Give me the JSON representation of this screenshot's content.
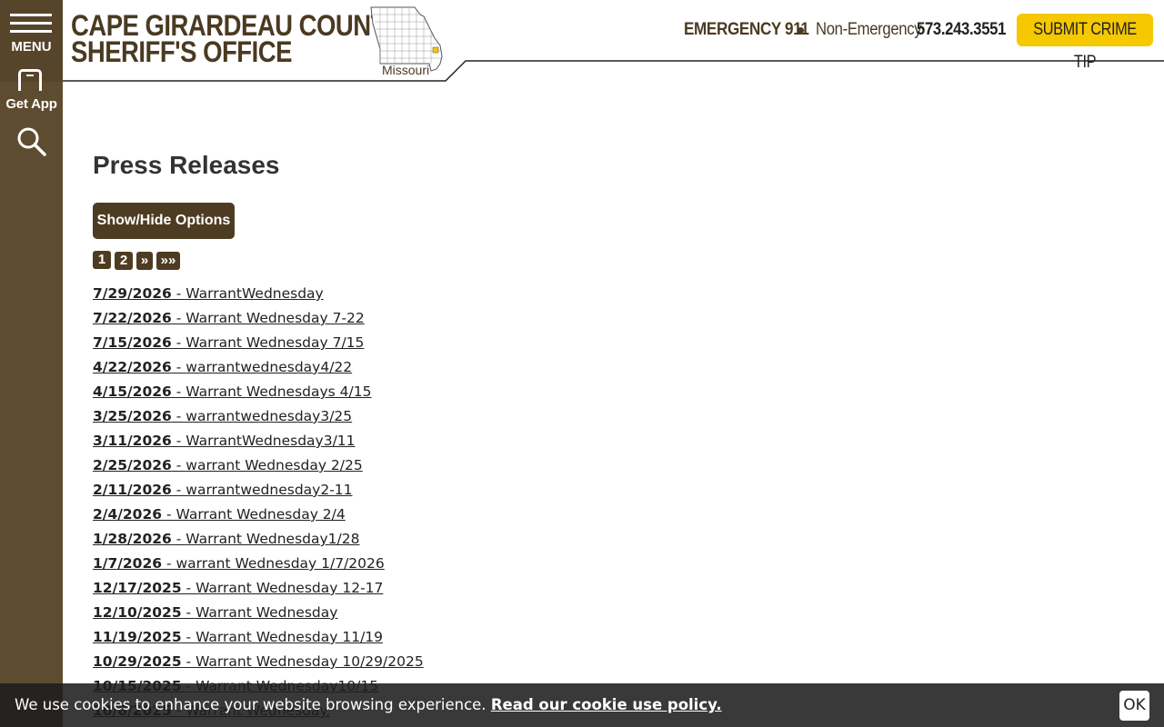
{
  "sidebar": {
    "menu_label": "MENU",
    "app_label": "Get App"
  },
  "header": {
    "brand_line1": "CAPE GIRARDEAU COUNTY",
    "brand_line2": "SHERIFF'S OFFICE",
    "state_label": "Missouri",
    "emergency_label": "EMERGENCY 911",
    "non_emergency_label": "Non-Emergency",
    "non_emergency_phone": "573.243.3551",
    "crime_tip_button": "SUBMIT CRIME TIP"
  },
  "main": {
    "title": "Press Releases",
    "options_button": "Show/Hide Options",
    "pagination": [
      {
        "label": "1",
        "current": true
      },
      {
        "label": "2",
        "current": false
      },
      {
        "label": "»",
        "current": false
      },
      {
        "label": "»»",
        "current": false
      }
    ],
    "releases": [
      {
        "date": "7/29/2026",
        "title": "WarrantWednesday"
      },
      {
        "date": "7/22/2026",
        "title": "Warrant Wednesday 7-22"
      },
      {
        "date": "7/15/2026",
        "title": "Warrant Wednesday 7/15"
      },
      {
        "date": "4/22/2026",
        "title": "warrantwednesday4/22"
      },
      {
        "date": "4/15/2026",
        "title": "Warrant Wednesdays 4/15"
      },
      {
        "date": "3/25/2026",
        "title": "warrantwednesday3/25"
      },
      {
        "date": "3/11/2026",
        "title": "WarrantWednesday3/11"
      },
      {
        "date": "2/25/2026",
        "title": "warrant Wednesday 2/25"
      },
      {
        "date": "2/11/2026",
        "title": "warrantwednesday2-11"
      },
      {
        "date": "2/4/2026",
        "title": "Warrant Wednesday 2/4"
      },
      {
        "date": "1/28/2026",
        "title": "Warrant Wednesday1/28"
      },
      {
        "date": "1/7/2026",
        "title": "warrant Wednesday 1/7/2026"
      },
      {
        "date": "12/17/2025",
        "title": "Warrant Wednesday 12-17"
      },
      {
        "date": "12/10/2025",
        "title": "Warrant Wednesday"
      },
      {
        "date": "11/19/2025",
        "title": "Warrant Wednesday 11/19"
      },
      {
        "date": "10/29/2025",
        "title": "Warrant Wednesday 10/29/2025"
      },
      {
        "date": "10/15/2025",
        "title": "Warrant Wednesday10/15"
      },
      {
        "date": "10/8/2025",
        "title": "Warrant Wednesday."
      }
    ],
    "separator": " - "
  },
  "cookie": {
    "message": "We use cookies to enhance your website browsing experience.",
    "policy_link": "Read our cookie use policy.",
    "ok_button": "OK"
  },
  "colors": {
    "sidebar": "#5e4c30",
    "brand": "#4a3a22",
    "accent": "#f5c800",
    "button": "#4e3c22"
  }
}
